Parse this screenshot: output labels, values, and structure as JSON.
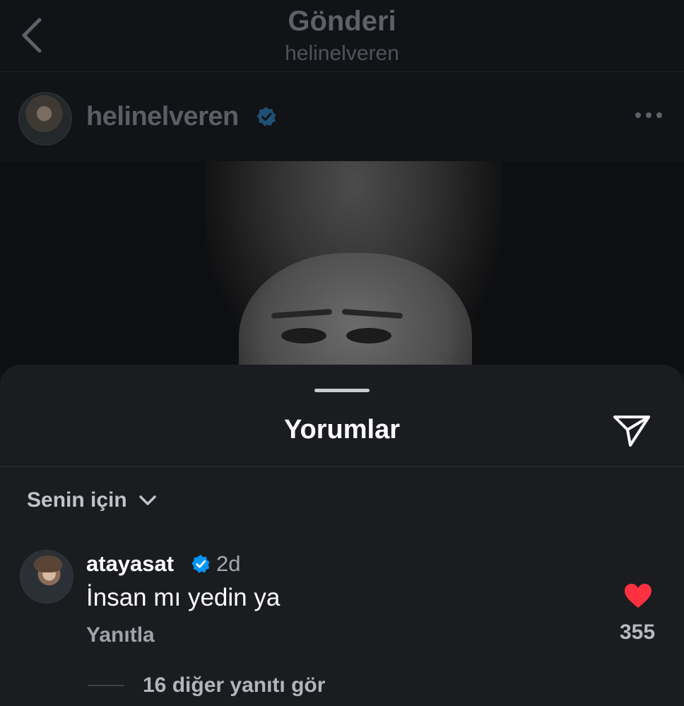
{
  "header": {
    "title": "Gönderi",
    "subtitle": "helinelveren",
    "back_icon": "chevron-left-icon"
  },
  "post": {
    "author": "helinelveren",
    "verified": true,
    "more_icon": "ellipsis-icon"
  },
  "comments_sheet": {
    "title": "Yorumlar",
    "share_icon": "paper-plane-icon",
    "filter": {
      "label": "Senin için",
      "icon": "chevron-down-icon"
    },
    "comments": [
      {
        "username": "atayasat",
        "verified": true,
        "time": "2d",
        "text": "İnsan mı yedin ya",
        "reply_label": "Yanıtla",
        "liked": true,
        "like_count": "355",
        "more_replies_label": "16 diğer yanıtı gör"
      }
    ]
  },
  "colors": {
    "sheet_background": "#1a1c20",
    "verified_blue": "#0095f6",
    "like_red": "#ff3040"
  }
}
